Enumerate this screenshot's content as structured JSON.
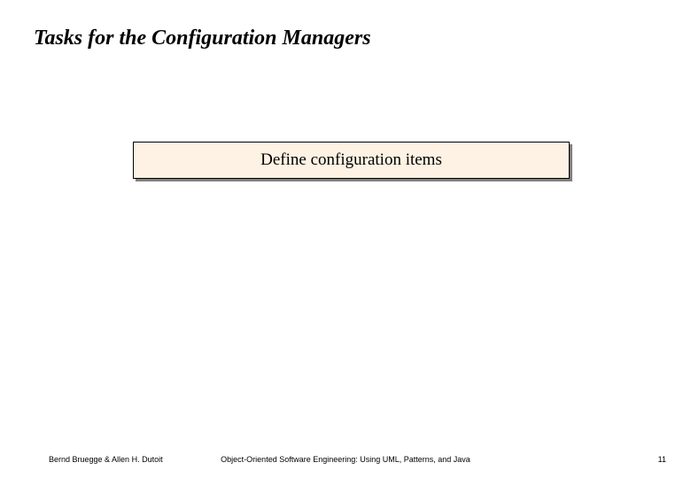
{
  "slide": {
    "title": "Tasks for the Configuration Managers",
    "task_box": {
      "label": "Define configuration items"
    }
  },
  "footer": {
    "authors": "Bernd Bruegge & Allen H. Dutoit",
    "book": "Object-Oriented Software Engineering: Using UML, Patterns, and Java",
    "page": "11"
  }
}
